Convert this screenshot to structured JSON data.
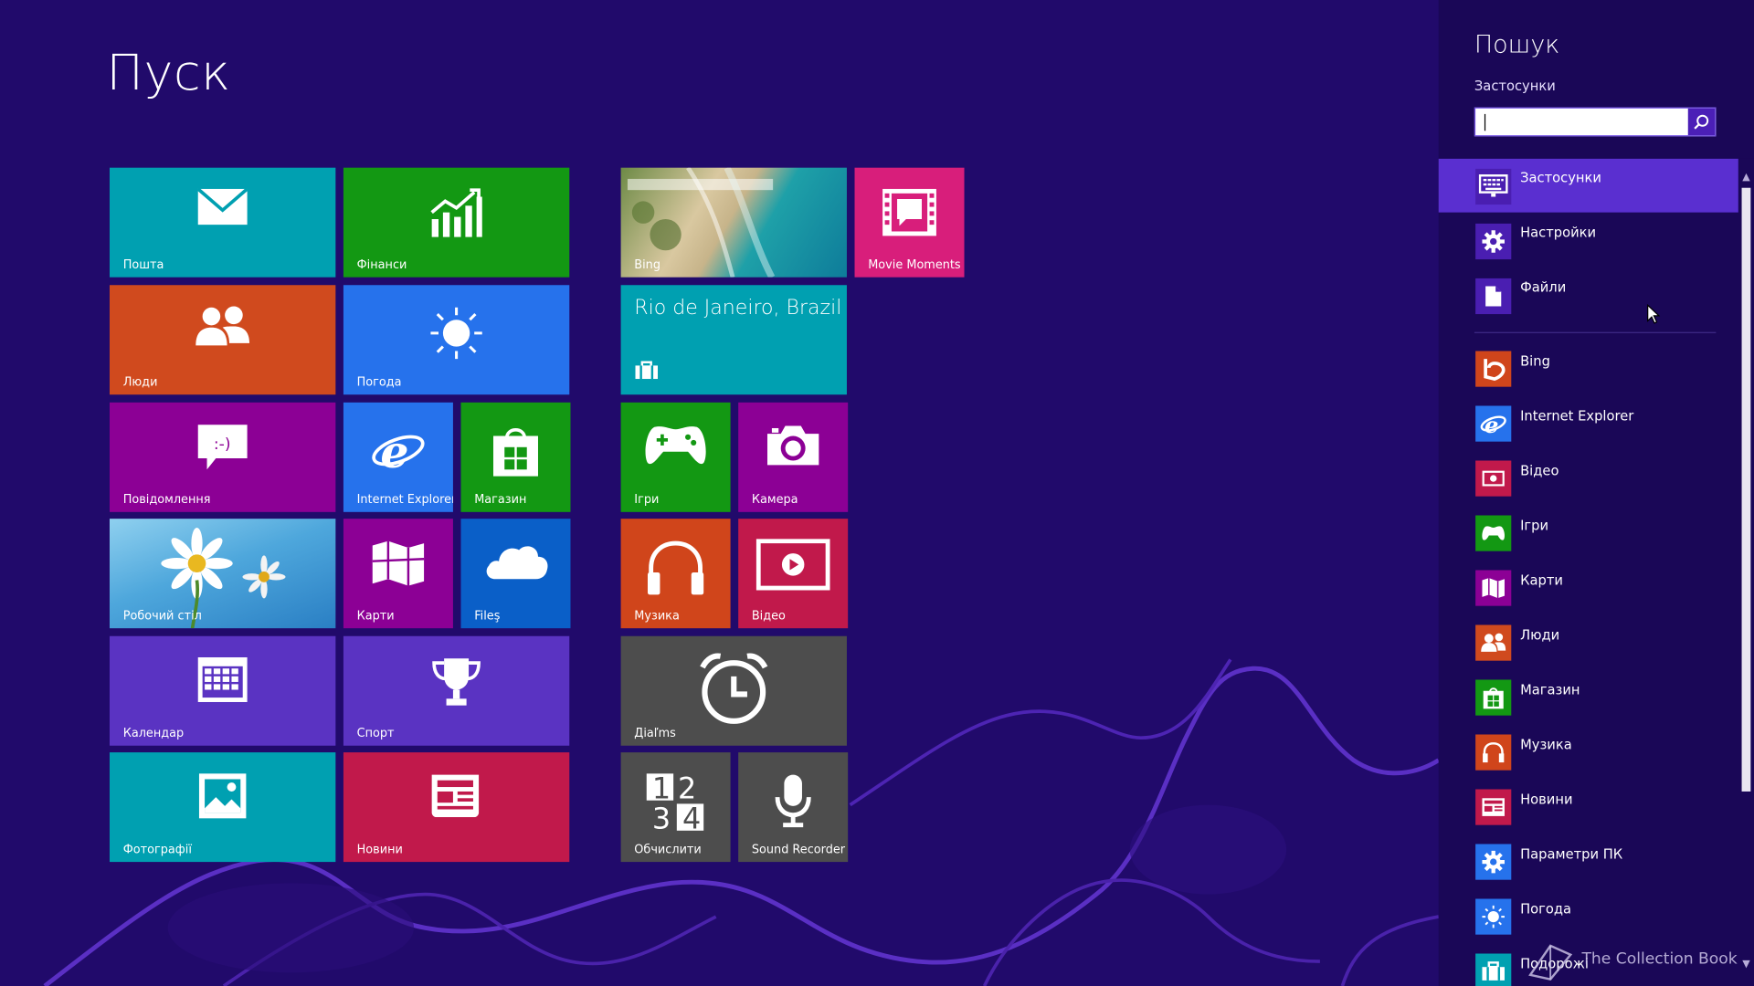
{
  "start": {
    "title": "Пуск"
  },
  "tiles": {
    "mail": "Пошта",
    "finance": "Фінанси",
    "bing": "Bing",
    "movie_moments": "Movie Moments",
    "people": "Люди",
    "weather": "Погода",
    "travel": "Rio de Janeiro, Brazil",
    "messaging": "Повідомлення",
    "ie": "Internet Explorer",
    "store": "Магазин",
    "games": "Ігри",
    "camera": "Камера",
    "desktop": "Робочий стіл",
    "maps": "Карти",
    "files": "Fileş",
    "music": "Музика",
    "video": "Відео",
    "calendar": "Календар",
    "sports": "Спорт",
    "alarms": "Дiaľms",
    "photos": "Фотографії",
    "news": "Новини",
    "calculator": "Обчислити",
    "sound_recorder": "Sound Recorder"
  },
  "search": {
    "title": "Пошук",
    "scope": "Застосунки",
    "query": "",
    "scopes": [
      {
        "label": "Застосунки",
        "icon": "apps-icon",
        "selected": true
      },
      {
        "label": "Настройки",
        "icon": "gear-icon"
      },
      {
        "label": "Файли",
        "icon": "file-icon"
      }
    ],
    "apps": [
      {
        "label": "Bing",
        "icon": "bing-icon",
        "color": "#d0451b"
      },
      {
        "label": "Internet Explorer",
        "icon": "ie-icon",
        "color": "#2672ec"
      },
      {
        "label": "Відео",
        "icon": "video-icon",
        "color": "#c1194b"
      },
      {
        "label": "Ігри",
        "icon": "games-icon",
        "color": "#139813"
      },
      {
        "label": "Карти",
        "icon": "maps-icon",
        "color": "#8c0095"
      },
      {
        "label": "Люди",
        "icon": "people-icon",
        "color": "#d04a1e"
      },
      {
        "label": "Магазин",
        "icon": "store-icon",
        "color": "#139813"
      },
      {
        "label": "Музика",
        "icon": "music-icon",
        "color": "#d0451b"
      },
      {
        "label": "Новини",
        "icon": "news-icon",
        "color": "#c1194b"
      },
      {
        "label": "Параметри ПК",
        "icon": "pc-settings-icon",
        "color": "#2672ec"
      },
      {
        "label": "Погода",
        "icon": "weather-icon",
        "color": "#2672ec"
      },
      {
        "label": "Подорожі",
        "icon": "travel-icon",
        "color": "#00a0b1"
      }
    ]
  },
  "watermark": "The Collection Book"
}
